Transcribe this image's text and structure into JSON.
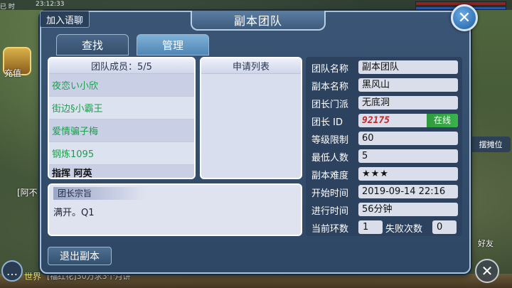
{
  "background": {
    "status_time": "已 时",
    "clock": "23:12:33",
    "left_icon_label": "充值",
    "chat_line": "[阿不",
    "world_tag": "世界",
    "world_text": "[福红花]30万求3个月饼",
    "stall_label": "摆摊位",
    "friends_label": "好友"
  },
  "dialog": {
    "title": "副本团队",
    "join_voice": "加入语聊",
    "close_icon": "close-icon"
  },
  "tabs": [
    {
      "label": "查找",
      "active": false
    },
    {
      "label": "管理",
      "active": true
    }
  ],
  "members": {
    "header": "团队成员：5/5",
    "list": [
      "夜恋い小欣",
      "街边§小霸王",
      "爱情骗子梅",
      "钢炼1095",
      "指挥 阿英"
    ]
  },
  "apply": {
    "header": "申请列表"
  },
  "motto": {
    "label": "团长宗旨",
    "text": "满开。Q1"
  },
  "exit_button": "退出副本",
  "info": {
    "team_name_label": "团队名称",
    "team_name": "副本团队",
    "dungeon_name_label": "副本名称",
    "dungeon_name": "黑风山",
    "leader_sect_label": "团长门派",
    "leader_sect": "无底洞",
    "leader_id_label": "团长 ID",
    "leader_id": "92175",
    "online_label": "在线",
    "level_limit_label": "等级限制",
    "level_limit": "60",
    "min_people_label": "最低人数",
    "min_people": "5",
    "difficulty_label": "副本难度",
    "difficulty": "★★★",
    "start_time_label": "开始时间",
    "start_time": "2019-09-14 22:16",
    "elapsed_label": "进行时间",
    "elapsed": "56分钟",
    "current_round_label": "当前环数",
    "current_round": "1",
    "fail_count_label": "失败次数",
    "fail_count": "0"
  },
  "colors": {
    "member_name": "#1b9e4b",
    "online_badge": "#2f9a3e",
    "dialog_bg": "#3a5575"
  }
}
